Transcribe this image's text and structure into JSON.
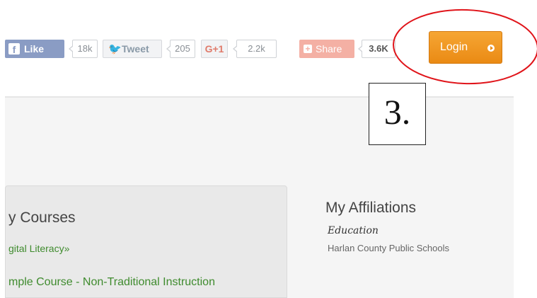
{
  "social": {
    "facebook": {
      "label": "Like",
      "count": "18k",
      "icon": "facebook-icon",
      "glyph": "f"
    },
    "twitter": {
      "label": "Tweet",
      "count": "205",
      "icon": "twitter-bird-icon",
      "glyph": "🐦"
    },
    "googleplus": {
      "label": "G+1",
      "count": "2.2k"
    },
    "share": {
      "label": "Share",
      "count": "3.6K",
      "icon": "plus-icon",
      "glyph": "+"
    }
  },
  "login": {
    "label": "Login",
    "icon": "play-circle-icon"
  },
  "annotation": {
    "step": "3.",
    "highlight_color": "#e0141a"
  },
  "courses": {
    "title": "y Courses",
    "items": [
      {
        "label": "gital Literacy»"
      },
      {
        "label": "mple Course - Non-Traditional Instruction"
      }
    ]
  },
  "affiliations": {
    "title": "My Affiliations",
    "category": "Education",
    "organization": "Harlan County Public Schools"
  },
  "colors": {
    "accent_orange": "#ea8a14",
    "link_green": "#3f8b2e",
    "facebook": "#8a9cc4",
    "share": "#f4b0a4"
  }
}
